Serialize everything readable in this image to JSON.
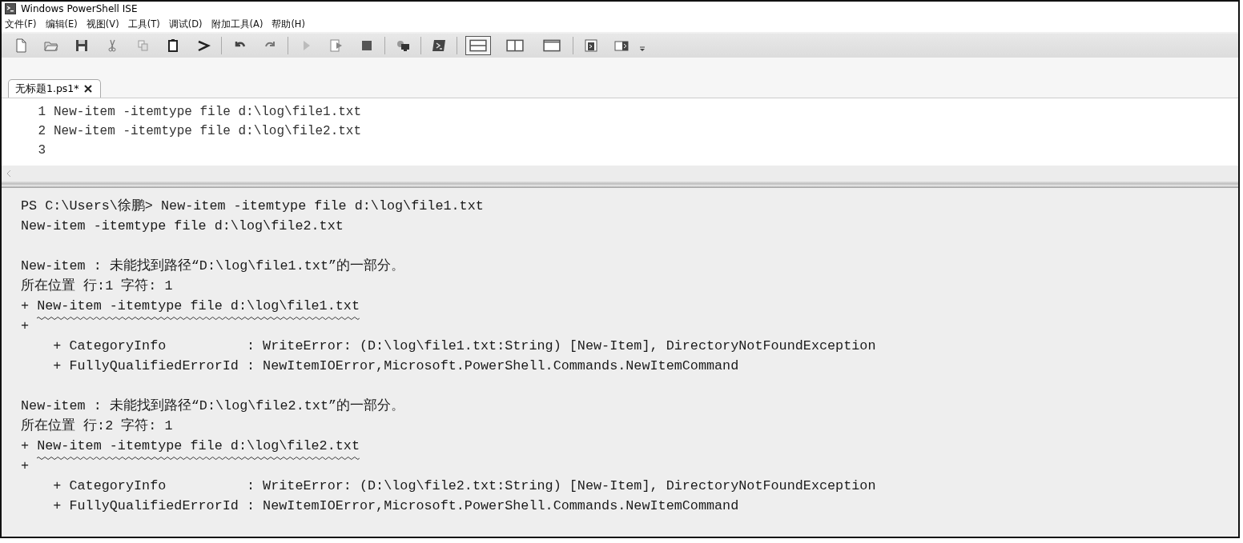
{
  "window": {
    "title": "Windows PowerShell ISE"
  },
  "menu": [
    "文件(F)",
    "编辑(E)",
    "视图(V)",
    "工具(T)",
    "调试(D)",
    "附加工具(A)",
    "帮助(H)"
  ],
  "toolbar": {
    "layout_options": [
      {
        "selected": true
      },
      {
        "selected": false
      },
      {
        "selected": false
      }
    ]
  },
  "tabs": [
    {
      "label": "无标题1.ps1*",
      "selected": true
    }
  ],
  "editor": {
    "lines": [
      {
        "number": "1",
        "code": "New-item -itemtype file d:\\log\\file1.txt"
      },
      {
        "number": "2",
        "code": "New-item -itemtype file d:\\log\\file2.txt"
      },
      {
        "number": "3"
      }
    ]
  },
  "console": {
    "lines": [
      {
        "kind": "text",
        "text": "PS C:\\Users\\徐鹏> New-item -itemtype file d:\\log\\file1.txt"
      },
      {
        "kind": "text",
        "text": "New-item -itemtype file d:\\log\\file2.txt"
      },
      {
        "kind": "blank"
      },
      {
        "kind": "text",
        "text": "New-item : 未能找到路径“D:\\log\\file1.txt”的一部分。"
      },
      {
        "kind": "text",
        "text": "所在位置 行:1 字符: 1"
      },
      {
        "kind": "command",
        "prefix": "+",
        "text": "New-item -itemtype file d:\\log\\file1.txt"
      },
      {
        "kind": "squiggle",
        "text": "+"
      },
      {
        "kind": "detail",
        "text": "+ CategoryInfo          : WriteError: (D:\\log\\file1.txt:String) [New-Item], DirectoryNotFoundException"
      },
      {
        "kind": "detail",
        "text": "+ FullyQualifiedErrorId : NewItemIOError,Microsoft.PowerShell.Commands.NewItemCommand"
      },
      {
        "kind": "blank"
      },
      {
        "kind": "text",
        "text": "New-item : 未能找到路径“D:\\log\\file2.txt”的一部分。"
      },
      {
        "kind": "text",
        "text": "所在位置 行:2 字符: 1"
      },
      {
        "kind": "command",
        "prefix": "+",
        "text": "New-item -itemtype file d:\\log\\file2.txt"
      },
      {
        "kind": "squiggle",
        "text": "+"
      },
      {
        "kind": "detail",
        "text": "+ CategoryInfo          : WriteError: (D:\\log\\file2.txt:String) [New-Item], DirectoryNotFoundException"
      },
      {
        "kind": "detail",
        "text": "+ FullyQualifiedErrorId : NewItemIOError,Microsoft.PowerShell.Commands.NewItemCommand"
      }
    ]
  }
}
